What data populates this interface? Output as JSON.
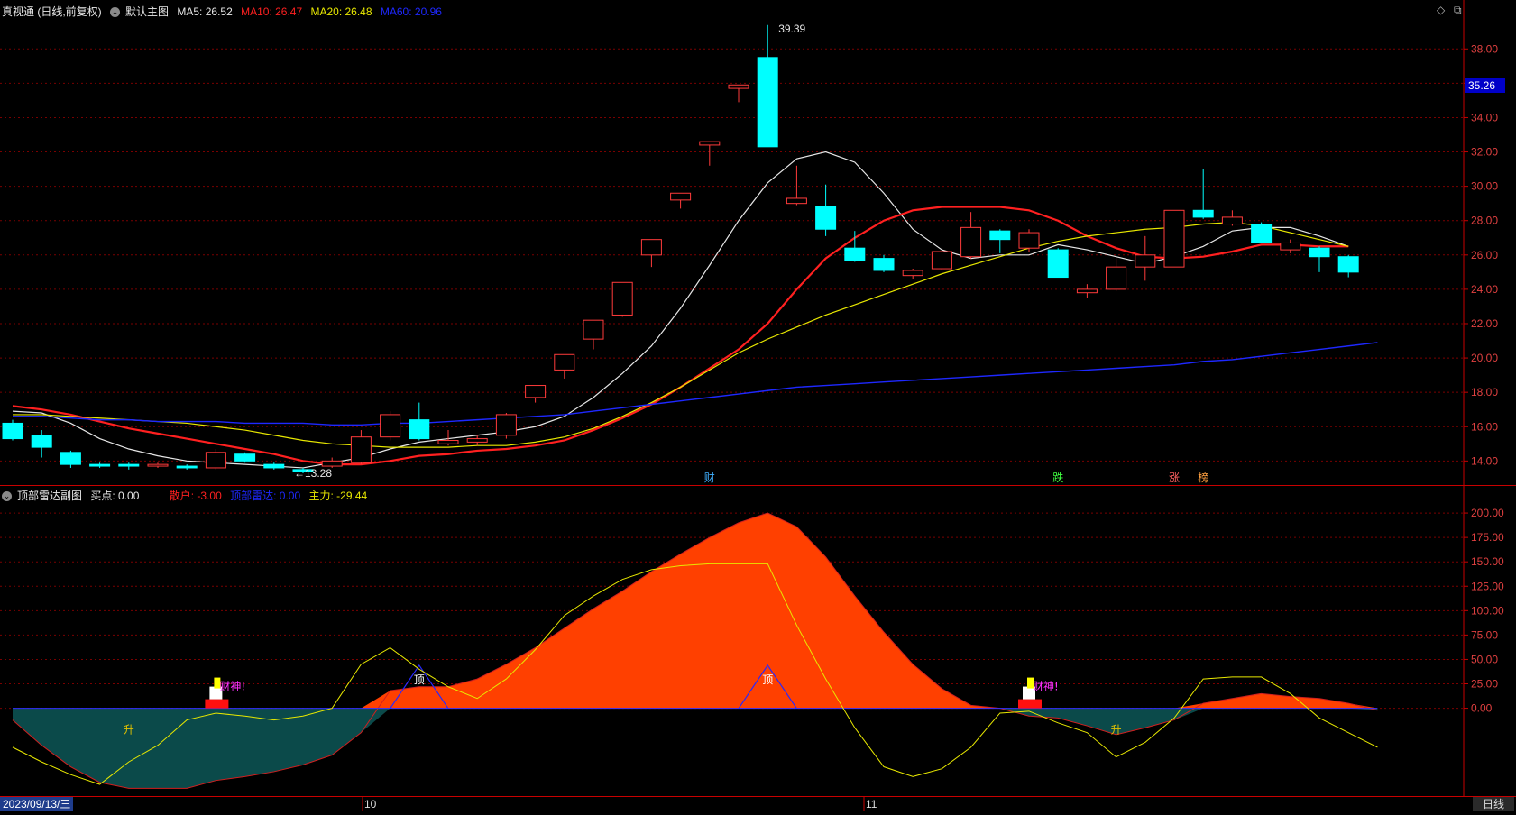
{
  "main_header": {
    "app_title": "真视通 (日线,前复权)",
    "template_label": "默认主图",
    "ma5": "MA5: 26.52",
    "ma10": "MA10: 26.47",
    "ma20": "MA20: 26.48",
    "ma60": "MA60: 20.96"
  },
  "sub_header": {
    "title": "顶部雷达副图",
    "buy_point": "买点: 0.00",
    "retail": "散户: -3.00",
    "top_radar": "顶部雷达: 0.00",
    "main_force": "主力: -29.44"
  },
  "window_icons": {
    "diamond": "◇",
    "restore": "⧉"
  },
  "current_price_tag": "35.26",
  "footer": {
    "date": "2023/09/13/三",
    "month_10": "10",
    "month_11": "11",
    "period": "日线"
  },
  "colors": {
    "up": "#ff3b3b",
    "down": "#00ffff",
    "ma5": "#e6e6e6",
    "ma10": "#ff2020",
    "ma20": "#e8e800",
    "ma60": "#1e28ff",
    "grid": "#7a0000",
    "axis": "#c80000",
    "area": "#ff4000",
    "teal": "#0b4a4a"
  },
  "chart_data": [
    {
      "type": "candlestick",
      "title": "默认主图",
      "ylim": [
        12.6,
        39.8
      ],
      "yticks": [
        "14.00",
        "16.00",
        "18.00",
        "20.00",
        "22.00",
        "24.00",
        "26.00",
        "28.00",
        "30.00",
        "32.00",
        "34.00",
        "36.00",
        "38.00"
      ],
      "candles": [
        {
          "o": 16.2,
          "h": 16.4,
          "l": 15.2,
          "c": 15.3
        },
        {
          "o": 15.5,
          "h": 15.8,
          "l": 14.2,
          "c": 14.8
        },
        {
          "o": 14.5,
          "h": 14.6,
          "l": 13.6,
          "c": 13.8
        },
        {
          "o": 13.8,
          "h": 13.9,
          "l": 13.6,
          "c": 13.7
        },
        {
          "o": 13.8,
          "h": 13.9,
          "l": 13.5,
          "c": 13.7
        },
        {
          "o": 13.7,
          "h": 13.9,
          "l": 13.6,
          "c": 13.8
        },
        {
          "o": 13.7,
          "h": 13.8,
          "l": 13.5,
          "c": 13.6
        },
        {
          "o": 13.6,
          "h": 14.7,
          "l": 13.5,
          "c": 14.5
        },
        {
          "o": 14.4,
          "h": 14.5,
          "l": 13.9,
          "c": 14.0
        },
        {
          "o": 13.8,
          "h": 13.9,
          "l": 13.5,
          "c": 13.6
        },
        {
          "o": 13.5,
          "h": 13.6,
          "l": 13.28,
          "c": 13.4
        },
        {
          "o": 13.7,
          "h": 14.2,
          "l": 13.6,
          "c": 14.0
        },
        {
          "o": 13.9,
          "h": 15.8,
          "l": 13.8,
          "c": 15.4
        },
        {
          "o": 15.4,
          "h": 16.9,
          "l": 15.2,
          "c": 16.7
        },
        {
          "o": 16.4,
          "h": 17.4,
          "l": 15.2,
          "c": 15.3
        },
        {
          "o": 15.0,
          "h": 15.8,
          "l": 14.9,
          "c": 15.2
        },
        {
          "o": 15.1,
          "h": 15.5,
          "l": 14.9,
          "c": 15.3
        },
        {
          "o": 15.5,
          "h": 16.8,
          "l": 15.3,
          "c": 16.7
        },
        {
          "o": 17.7,
          "h": 18.4,
          "l": 17.4,
          "c": 18.4
        },
        {
          "o": 19.3,
          "h": 20.2,
          "l": 18.8,
          "c": 20.2
        },
        {
          "o": 21.1,
          "h": 22.2,
          "l": 20.5,
          "c": 22.2
        },
        {
          "o": 22.5,
          "h": 24.4,
          "l": 22.4,
          "c": 24.4
        },
        {
          "o": 26.0,
          "h": 26.9,
          "l": 25.3,
          "c": 26.9
        },
        {
          "o": 29.2,
          "h": 29.6,
          "l": 28.7,
          "c": 29.6
        },
        {
          "o": 32.4,
          "h": 32.6,
          "l": 31.2,
          "c": 32.6
        },
        {
          "o": 35.7,
          "h": 35.9,
          "l": 34.9,
          "c": 35.9
        },
        {
          "o": 37.5,
          "h": 39.39,
          "l": 32.3,
          "c": 32.3
        },
        {
          "o": 29.0,
          "h": 31.2,
          "l": 28.9,
          "c": 29.3
        },
        {
          "o": 28.8,
          "h": 30.1,
          "l": 27.1,
          "c": 27.5
        },
        {
          "o": 26.4,
          "h": 27.4,
          "l": 25.6,
          "c": 25.7
        },
        {
          "o": 25.8,
          "h": 26.0,
          "l": 25.0,
          "c": 25.1
        },
        {
          "o": 24.8,
          "h": 25.2,
          "l": 24.6,
          "c": 25.1
        },
        {
          "o": 25.2,
          "h": 26.2,
          "l": 25.1,
          "c": 26.2
        },
        {
          "o": 25.9,
          "h": 28.5,
          "l": 25.8,
          "c": 27.6
        },
        {
          "o": 27.4,
          "h": 27.5,
          "l": 26.1,
          "c": 26.9
        },
        {
          "o": 26.4,
          "h": 27.5,
          "l": 26.2,
          "c": 27.3
        },
        {
          "o": 26.3,
          "h": 26.4,
          "l": 24.7,
          "c": 24.7
        },
        {
          "o": 23.8,
          "h": 24.3,
          "l": 23.5,
          "c": 24.0
        },
        {
          "o": 24.0,
          "h": 25.8,
          "l": 23.9,
          "c": 25.3
        },
        {
          "o": 25.3,
          "h": 27.1,
          "l": 24.5,
          "c": 26.0
        },
        {
          "o": 25.3,
          "h": 28.6,
          "l": 25.3,
          "c": 28.6
        },
        {
          "o": 28.6,
          "h": 31.0,
          "l": 28.1,
          "c": 28.2
        },
        {
          "o": 27.8,
          "h": 28.6,
          "l": 27.7,
          "c": 28.2
        },
        {
          "o": 27.8,
          "h": 27.9,
          "l": 26.7,
          "c": 26.7
        },
        {
          "o": 26.3,
          "h": 26.9,
          "l": 26.1,
          "c": 26.7
        },
        {
          "o": 26.4,
          "h": 26.5,
          "l": 25.0,
          "c": 25.9
        },
        {
          "o": 25.9,
          "h": 26.0,
          "l": 24.7,
          "c": 25.0
        }
      ],
      "ma_series": [
        {
          "name": "MA5",
          "values": [
            16.9,
            16.8,
            16.2,
            15.3,
            14.7,
            14.3,
            14.0,
            13.9,
            13.8,
            13.7,
            13.6,
            13.9,
            14.2,
            14.7,
            15.1,
            15.3,
            15.5,
            15.7,
            16.0,
            16.6,
            17.7,
            19.1,
            20.7,
            22.9,
            25.4,
            28.0,
            30.2,
            31.6,
            32.0,
            31.4,
            29.6,
            27.5,
            26.3,
            25.8,
            26.0,
            26.0,
            26.6,
            26.3,
            25.9,
            25.5,
            25.9,
            26.5,
            27.4,
            27.6,
            27.6,
            27.1,
            26.5
          ]
        },
        {
          "name": "MA10",
          "values": [
            17.2,
            17.0,
            16.7,
            16.3,
            15.9,
            15.6,
            15.3,
            15.0,
            14.7,
            14.4,
            14.0,
            13.8,
            13.8,
            14.0,
            14.3,
            14.4,
            14.6,
            14.7,
            14.9,
            15.2,
            15.8,
            16.5,
            17.3,
            18.3,
            19.4,
            20.5,
            22.0,
            24.0,
            25.8,
            27.0,
            28.0,
            28.6,
            28.8,
            28.8,
            28.8,
            28.6,
            28.0,
            27.1,
            26.4,
            25.9,
            25.8,
            25.9,
            26.2,
            26.6,
            26.6,
            26.5,
            26.5
          ]
        },
        {
          "name": "MA20",
          "values": [
            16.7,
            16.7,
            16.6,
            16.5,
            16.4,
            16.3,
            16.2,
            16.0,
            15.8,
            15.5,
            15.2,
            15.0,
            14.9,
            14.8,
            14.8,
            14.8,
            14.9,
            14.9,
            15.1,
            15.4,
            15.9,
            16.6,
            17.4,
            18.3,
            19.3,
            20.3,
            21.1,
            21.8,
            22.5,
            23.1,
            23.7,
            24.3,
            24.9,
            25.4,
            25.9,
            26.4,
            26.8,
            27.1,
            27.3,
            27.5,
            27.6,
            27.8,
            27.9,
            27.7,
            27.3,
            26.9,
            26.5
          ]
        },
        {
          "name": "MA60",
          "values": [
            16.6,
            16.6,
            16.5,
            16.4,
            16.4,
            16.3,
            16.3,
            16.3,
            16.2,
            16.2,
            16.2,
            16.1,
            16.1,
            16.2,
            16.2,
            16.3,
            16.4,
            16.5,
            16.6,
            16.7,
            16.9,
            17.1,
            17.3,
            17.5,
            17.7,
            17.9,
            18.1,
            18.3,
            18.4,
            18.5,
            18.6,
            18.7,
            18.8,
            18.9,
            19.0,
            19.1,
            19.2,
            19.3,
            19.4,
            19.5,
            19.6,
            19.8,
            19.9,
            20.1,
            20.3,
            20.5,
            20.7,
            20.9
          ]
        }
      ],
      "annotations": [
        {
          "text": "39.39",
          "index": 26,
          "value": 39.39
        },
        {
          "text": "13.28",
          "index": 10,
          "value": 13.28
        },
        {
          "text": "财",
          "index": 24,
          "color": "#40b0ff"
        },
        {
          "text": "跌",
          "index": 36,
          "color": "#40ff40"
        },
        {
          "text": "涨",
          "index": 40,
          "color": "#ff6060"
        },
        {
          "text": "榜",
          "index": 41,
          "color": "#ffa040"
        }
      ]
    },
    {
      "type": "area",
      "title": "顶部雷达副图",
      "ylim": [
        -90,
        213
      ],
      "yticks": [
        "0.00",
        "25.00",
        "50.00",
        "75.00",
        "100.00",
        "125.00",
        "150.00",
        "175.00",
        "200.00"
      ],
      "area_series": {
        "name": "散户",
        "values": [
          -12,
          -38,
          -60,
          -76,
          -82,
          -82,
          -82,
          -74,
          -70,
          -65,
          -58,
          -48,
          -25,
          18,
          22,
          22,
          30,
          45,
          62,
          82,
          102,
          120,
          140,
          158,
          175,
          190,
          200,
          186,
          155,
          115,
          78,
          45,
          20,
          3,
          0,
          -8,
          -10,
          -18,
          -27,
          -20,
          -12,
          5,
          10,
          15,
          12,
          10,
          5,
          -2
        ]
      },
      "line_series": {
        "name": "主力",
        "values": [
          -40,
          -55,
          -68,
          -78,
          -55,
          -38,
          -12,
          -5,
          -8,
          -12,
          -8,
          0,
          45,
          62,
          40,
          22,
          10,
          30,
          60,
          95,
          115,
          132,
          142,
          146,
          148,
          148,
          148,
          85,
          30,
          -20,
          -60,
          -70,
          -62,
          -40,
          -5,
          -3,
          -15,
          -25,
          -50,
          -35,
          -10,
          30,
          32,
          32,
          15,
          -10,
          -25,
          -40
        ]
      },
      "triangle_markers": [
        {
          "index": 14,
          "height": 44,
          "label": "顶"
        },
        {
          "index": 26,
          "height": 44,
          "label": "顶"
        }
      ],
      "buy_markers": [
        {
          "index": 7,
          "label": "财神!"
        },
        {
          "index": 35,
          "label": "财神!"
        }
      ],
      "up_labels": [
        {
          "index": 4,
          "label": "升"
        },
        {
          "index": 38,
          "label": "升"
        }
      ]
    }
  ]
}
